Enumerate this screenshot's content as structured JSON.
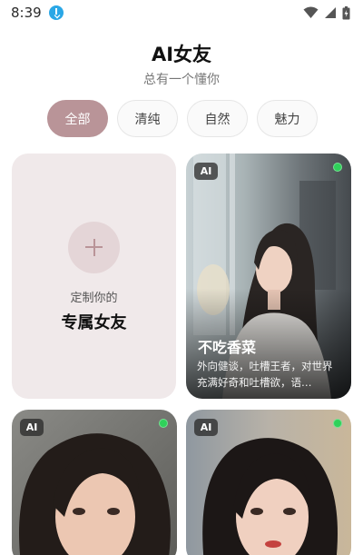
{
  "status_bar": {
    "time": "8:39",
    "icons": [
      "download-icon",
      "wifi-icon",
      "signal-icon",
      "battery-icon"
    ]
  },
  "header": {
    "title": "AI女友",
    "subtitle": "总有一个懂你"
  },
  "tabs": [
    {
      "label": "全部",
      "active": true
    },
    {
      "label": "清纯",
      "active": false
    },
    {
      "label": "自然",
      "active": false
    },
    {
      "label": "魅力",
      "active": false
    }
  ],
  "custom_card": {
    "line1": "定制你的",
    "line2": "专属女友"
  },
  "cards": [
    {
      "badge": "AI",
      "name": "不吃香菜",
      "description": "外向健谈，吐槽王者，对世界充满好奇和吐槽欲，语…",
      "online": true
    },
    {
      "badge": "AI",
      "online": true
    },
    {
      "badge": "AI",
      "online": true
    }
  ],
  "colors": {
    "accent": "#b99498",
    "online": "#2fd15a",
    "custom_card_bg": "#f0e9ea"
  }
}
